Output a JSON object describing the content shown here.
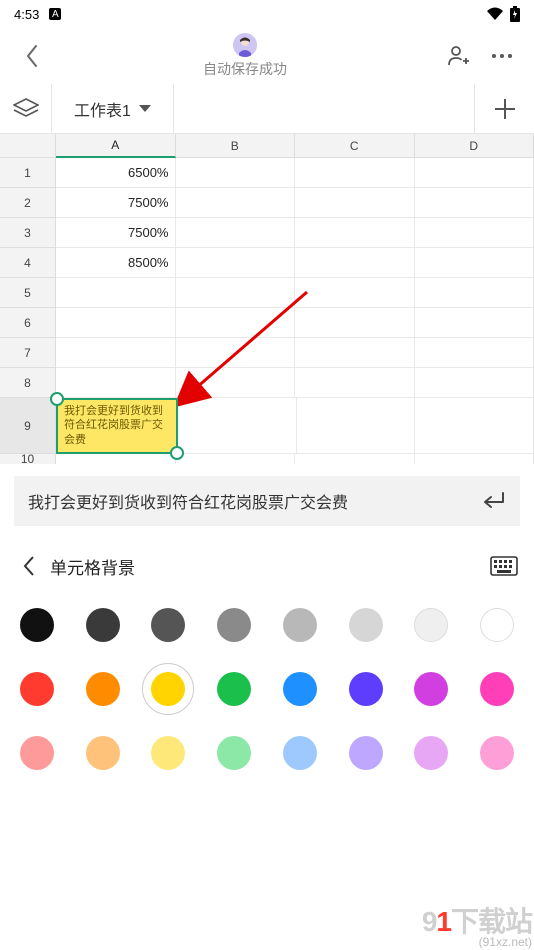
{
  "status": {
    "time": "4:53",
    "net_icon": "A"
  },
  "header": {
    "save_status": "自动保存成功"
  },
  "tabs": {
    "sheet_name": "工作表1"
  },
  "columns": [
    "A",
    "B",
    "C",
    "D"
  ],
  "rows": [
    {
      "n": "1",
      "a": "6500%"
    },
    {
      "n": "2",
      "a": "7500%"
    },
    {
      "n": "3",
      "a": "7500%"
    },
    {
      "n": "4",
      "a": "8500%"
    },
    {
      "n": "5",
      "a": ""
    },
    {
      "n": "6",
      "a": ""
    },
    {
      "n": "7",
      "a": ""
    },
    {
      "n": "8",
      "a": ""
    }
  ],
  "selected_row": {
    "n": "9",
    "text": "我打会更好到货收到符合红花岗股票广交会费"
  },
  "partial_row": {
    "n": "10"
  },
  "formula_bar": {
    "text": "我打会更好到货收到符合红花岗股票广交会费"
  },
  "panel": {
    "title": "单元格背景"
  },
  "swatches": {
    "row1": [
      "#111111",
      "#3a3a3a",
      "#555555",
      "#8a8a8a",
      "#b8b8b8",
      "#d6d6d6",
      "#efefef",
      "#ffffff"
    ],
    "row2": [
      "#ff3b30",
      "#ff8c00",
      "#ffd400",
      "#1bbf4b",
      "#1e90ff",
      "#5e3dff",
      "#d23fe0",
      "#ff3fb8"
    ],
    "row3": [
      "#ff9a9a",
      "#ffc27a",
      "#ffe87a",
      "#8ce8a7",
      "#9ec9ff",
      "#bda7ff",
      "#e7a7f5",
      "#ff9fd8"
    ],
    "selected": "#ffd400"
  },
  "watermark": {
    "brand_prefix": "9",
    "brand_accent": "1",
    "brand_suffix": "下载站",
    "url": "(91xz.net)"
  }
}
